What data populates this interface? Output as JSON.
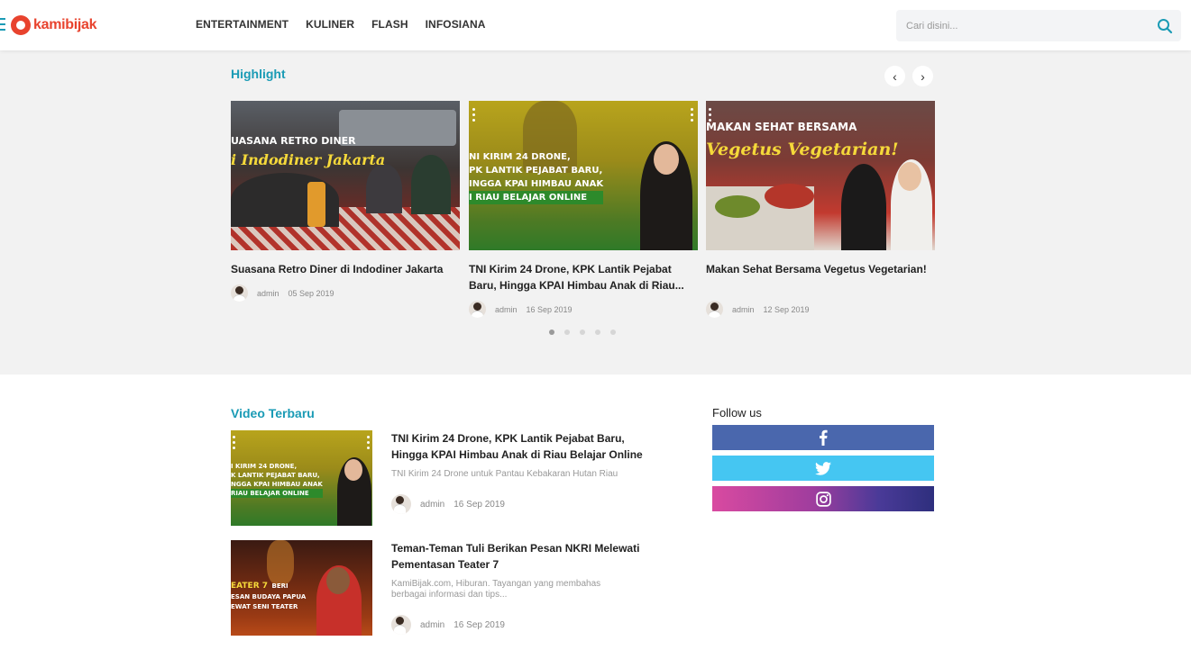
{
  "header": {
    "logo_text": "kamibijak",
    "nav": [
      "ENTERTAINMENT",
      "KULINER",
      "FLASH",
      "INFOSIANA"
    ],
    "search_placeholder": "Cari disini..."
  },
  "highlight": {
    "title": "Highlight",
    "prev_label": "‹",
    "next_label": "›",
    "cards": [
      {
        "title": "Suasana Retro Diner di Indodiner Jakarta",
        "author": "admin",
        "date": "05 Sep 2019",
        "overlay_line1": "UASANA RETRO DINER",
        "overlay_line2": "i Indodiner Jakarta"
      },
      {
        "title": "TNI Kirim 24 Drone, KPK Lantik Pejabat Baru, Hingga KPAI Himbau Anak di Riau...",
        "author": "admin",
        "date": "16 Sep 2019",
        "overlay_lines": [
          "NI KIRIM 24 DRONE,",
          "PK LANTIK PEJABAT BARU,",
          "INGGA KPAI HIMBAU ANAK",
          "I RIAU BELAJAR ONLINE"
        ]
      },
      {
        "title": "Makan Sehat Bersama Vegetus Vegetarian!",
        "author": "admin",
        "date": "12 Sep 2019",
        "overlay_line1": "MAKAN SEHAT BERSAMA",
        "overlay_line2": "Vegetus Vegetarian!"
      }
    ],
    "dots": 5,
    "active_dot": 0
  },
  "videos": {
    "title": "Video Terbaru",
    "items": [
      {
        "title": "TNI Kirim 24 Drone, KPK Lantik Pejabat Baru, Hingga KPAI Himbau Anak di Riau Belajar Online",
        "desc": "TNI Kirim 24 Drone untuk Pantau Kebakaran Hutan Riau",
        "author": "admin",
        "date": "16 Sep 2019",
        "overlay_lines": [
          "I KIRIM 24 DRONE,",
          "K LANTIK PEJABAT BARU,",
          "NGGA KPAI HIMBAU ANAK",
          "RIAU BELAJAR ONLINE"
        ]
      },
      {
        "title": "Teman-Teman Tuli Berikan Pesan NKRI Melewati Pementasan Teater 7",
        "desc": "KamiBijak.com, Hiburan. Tayangan yang membahas berbagai informasi dan tips...",
        "author": "admin",
        "date": "16 Sep 2019",
        "overlay_line1": "EATER 7",
        "overlay_line1b": "BERI",
        "overlay_line2": "ESAN BUDAYA PAPUA",
        "overlay_line3": "EWAT SENI TEATER"
      }
    ]
  },
  "follow": {
    "title": "Follow us",
    "networks": [
      "facebook",
      "twitter",
      "instagram"
    ]
  },
  "colors": {
    "accent": "#1a9bb5",
    "brand": "#e8432e",
    "facebook": "#4a67ad",
    "twitter": "#45c6f2",
    "instagram_start": "#d94aa0",
    "instagram_end": "#2e2f7d"
  }
}
